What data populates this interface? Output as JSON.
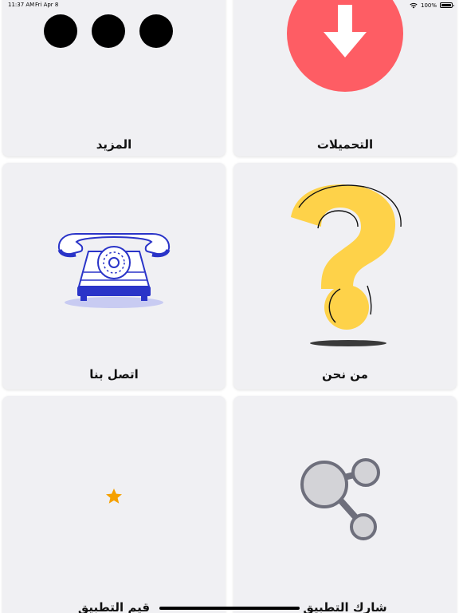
{
  "status_bar": {
    "time": "11:37 AM",
    "date": "Fri Apr 8",
    "battery": "100%"
  },
  "cards": {
    "more": {
      "label": "المزيد",
      "icon": "more-dots-icon"
    },
    "downloads": {
      "label": "التحميلات",
      "icon": "download-icon"
    },
    "contact": {
      "label": "اتصل بنا",
      "icon": "telephone-icon"
    },
    "about": {
      "label": "من نحن",
      "icon": "question-mark-icon"
    },
    "rate": {
      "label": "قيم التطبيق",
      "icon": "star-icon"
    },
    "share": {
      "label": "شارك التطبيق",
      "icon": "share-icon"
    }
  },
  "colors": {
    "card_bg": "#f0f0f3",
    "download_red": "#fe5d64",
    "question_yellow": "#fed249",
    "phone_blue": "#2a34c8",
    "star_orange": "#f5a000",
    "share_gray": "#6e6f7c"
  }
}
